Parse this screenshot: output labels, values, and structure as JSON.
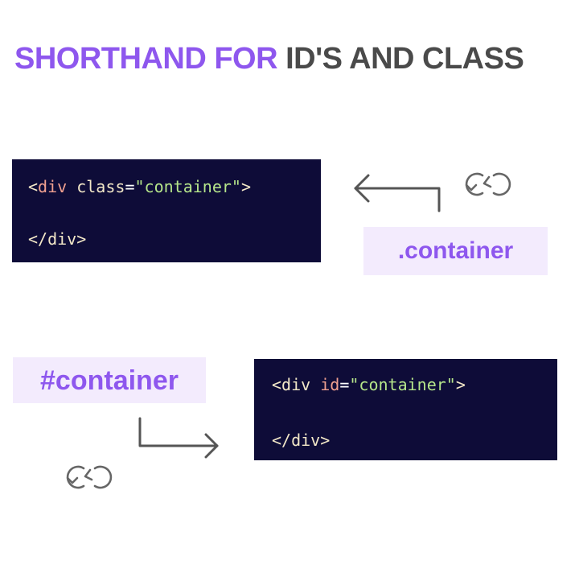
{
  "title": {
    "accent": "SHORTHAND FOR",
    "rest": "ID'S AND CLASS"
  },
  "class_example": {
    "open": {
      "lt": "<",
      "tag": "div",
      "attr": "class",
      "eq": "=",
      "value": "\"container\"",
      "gt": ">"
    },
    "close": "</div>",
    "shorthand": ".container"
  },
  "id_example": {
    "open": {
      "lt": "<",
      "tag": "div",
      "attr": "id",
      "eq": "=",
      "value": "\"container\"",
      "gt": ">"
    },
    "close": "</div>",
    "shorthand": "#container"
  },
  "icons": [
    "arrow-left-icon",
    "swap-icon",
    "arrow-right-icon",
    "swap-icon"
  ],
  "colors": {
    "accent": "#8e57ee",
    "code_bg": "#0e0c38",
    "pill_bg": "#f3ebfd",
    "title_dark": "#4a4a4a"
  }
}
